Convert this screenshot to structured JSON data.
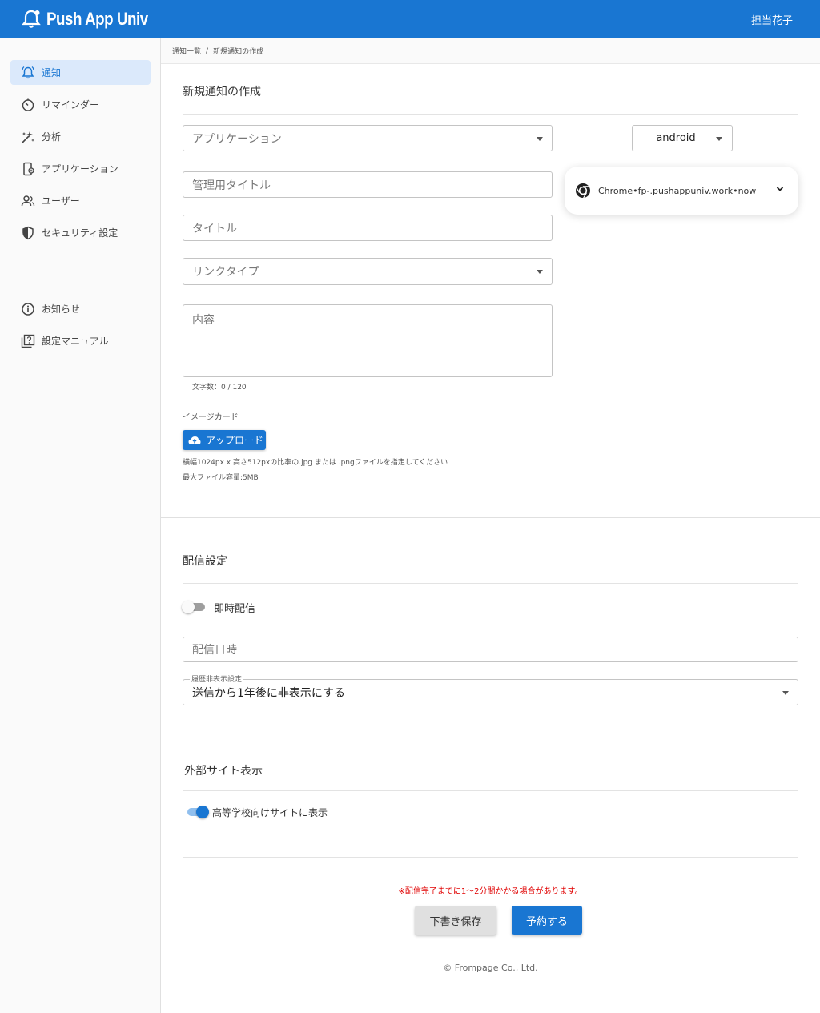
{
  "header": {
    "app_name": "Push App Univ",
    "user_name": "担当花子",
    "brand_color": "#1976d2"
  },
  "sidebar": {
    "items": [
      {
        "label": "通知",
        "icon": "bell-icon",
        "active": true
      },
      {
        "label": "リマインダー",
        "icon": "timer-icon"
      },
      {
        "label": "分析",
        "icon": "sparkle-icon"
      },
      {
        "label": "アプリケーション",
        "icon": "phone-icon"
      },
      {
        "label": "ユーザー",
        "icon": "users-icon"
      },
      {
        "label": "セキュリティ設定",
        "icon": "shield-icon"
      }
    ],
    "secondary_items": [
      {
        "label": "お知らせ",
        "icon": "info-icon"
      },
      {
        "label": "設定マニュアル",
        "icon": "help-book-icon"
      }
    ]
  },
  "breadcrumb": {
    "parent": "通知一覧",
    "separator": "/",
    "current": "新規通知の作成"
  },
  "form": {
    "title": "新規通知の作成",
    "application_placeholder": "アプリケーション",
    "platform_value": "android",
    "preview_text": "Chrome•fp-.pushappuniv.work•now",
    "admin_title_placeholder": "管理用タイトル",
    "title_placeholder": "タイトル",
    "link_type_placeholder": "リンクタイプ",
    "content_placeholder": "内容",
    "char_count": "文字数：0 / 120",
    "image_card_label": "イメージカード",
    "upload_label": "アップロード",
    "image_hint": "横幅1024px x 高さ512pxの比率の.jpg または .pngファイルを指定してください",
    "max_size": "最大ファイル容量:5MB"
  },
  "delivery": {
    "title": "配信設定",
    "immediate_label": "即時配信",
    "immediate_on": false,
    "datetime_placeholder": "配信日時",
    "history_label": "履歴非表示設定",
    "history_value": "送信から1年後に非表示にする"
  },
  "external": {
    "title": "外部サイト表示",
    "toggle_label": "高等学校向けサイトに表示",
    "toggle_on": true
  },
  "actions": {
    "notice": "※配信完了までに1～2分間かかる場合があります。",
    "draft_label": "下書き保存",
    "reserve_label": "予約する"
  },
  "footer": {
    "copyright": "© Frompage Co., Ltd."
  }
}
